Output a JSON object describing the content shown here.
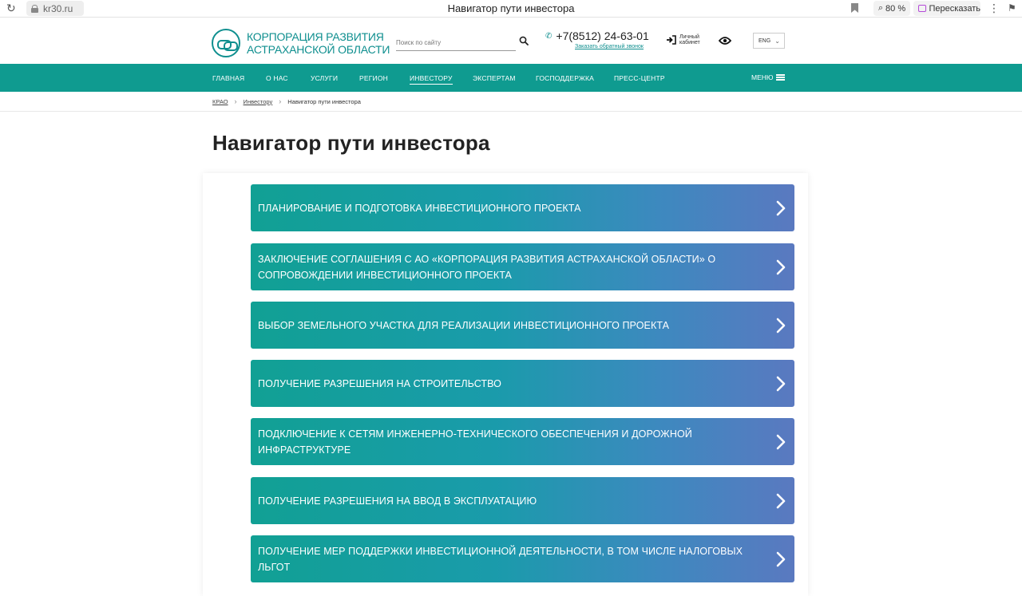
{
  "browser": {
    "url": "kr30.ru",
    "tab_title": "Навигатор пути инвестора",
    "zoom": "80 %",
    "retell_label": "Пересказать"
  },
  "header": {
    "logo_line1": "КОРПОРАЦИЯ РАЗВИТИЯ",
    "logo_line2": "АСТРАХАНСКОЙ ОБЛАСТИ",
    "search_placeholder": "Поиск по сайту",
    "phone": "+7(8512) 24-63-01",
    "callback_link": "Заказать обратный звонок",
    "cabinet_label": "Личный кабинет",
    "lang": "ENG",
    "brand_color": "#0f9b90"
  },
  "nav": {
    "items": [
      {
        "label": "Главная"
      },
      {
        "label": "О нас"
      },
      {
        "label": "Услуги"
      },
      {
        "label": "Регион"
      },
      {
        "label": "Инвестору"
      },
      {
        "label": "Экспертам"
      },
      {
        "label": "Господдержка"
      },
      {
        "label": "Пресс-центр"
      }
    ],
    "active": "Инвестору",
    "menu_label": "МЕНЮ"
  },
  "breadcrumb": {
    "items": [
      "КРАО",
      "Инвестору",
      "Навигатор пути инвестора"
    ]
  },
  "page_title": "Навигатор пути инвестора",
  "steps": [
    {
      "label": "Планирование и подготовка инвестиционного проекта"
    },
    {
      "label": "Заключение соглашения с АО «Корпорация развития Астраханской области» о сопровождении инвестиционного проекта"
    },
    {
      "label": "Выбор земельного участка для реализации инвестиционного проекта"
    },
    {
      "label": "Получение разрешения на строительство"
    },
    {
      "label": "Подключение к сетям инженерно-технического обеспечения и дорожной инфраструктуре"
    },
    {
      "label": "Получение разрешения на ввод в эксплуатацию"
    },
    {
      "label": "Получение мер поддержки инвестиционной деятельности, в том числе налоговых льгот"
    }
  ]
}
